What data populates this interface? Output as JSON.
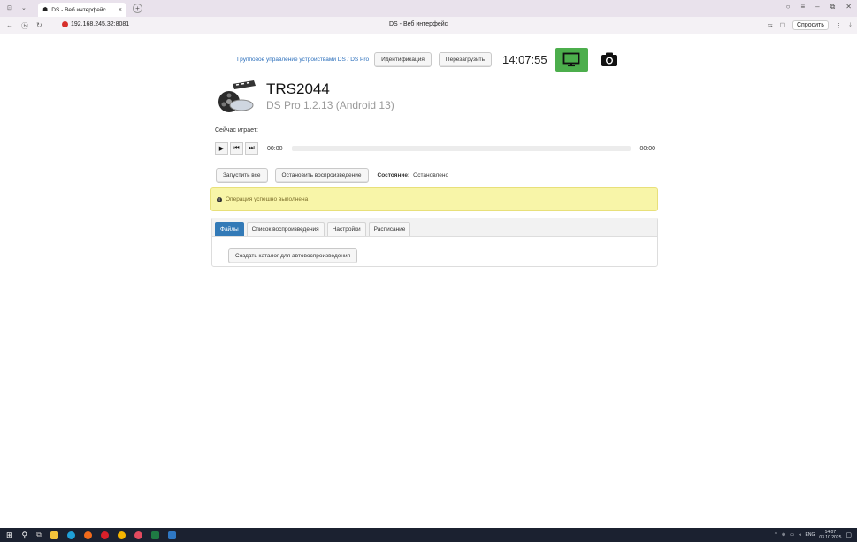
{
  "browser": {
    "tab_title": "DS - Веб интерфейс",
    "tab_close": "×",
    "new_tab": "+",
    "url": "192.168.245.32:8081",
    "page_title": "DS - Веб интерфейс",
    "ask_label": "Спросить"
  },
  "header": {
    "group_link": "Групповое управление устройствами DS / DS Pro",
    "identify_button": "Идентификация",
    "reboot_button": "Перезагрузить",
    "clock": "14:07:55",
    "screen_button_color": "#4cae4c"
  },
  "device": {
    "name": "TRS2044",
    "version": "DS Pro 1.2.13 (Android 13)"
  },
  "player": {
    "now_playing_label": "Сейчас играет:",
    "time_current": "00:00",
    "time_total": "00:00",
    "progress": 0
  },
  "controls": {
    "start_all": "Запустить все",
    "stop_playback": "Остановить воспроизведение",
    "state_label": "Состояние:",
    "state_value": "Остановлено"
  },
  "alert": {
    "text": "Операция успешно выполнена"
  },
  "tabs": [
    {
      "label": "Файлы",
      "active": true
    },
    {
      "label": "Список воспроизведения",
      "active": false
    },
    {
      "label": "Настройки",
      "active": false
    },
    {
      "label": "Расписание",
      "active": false
    }
  ],
  "files": {
    "create_catalog_button": "Создать каталог для автовоспроизведения"
  },
  "taskbar": {
    "lang": "ENG",
    "time": "14:07",
    "date": "03.10.2025"
  }
}
